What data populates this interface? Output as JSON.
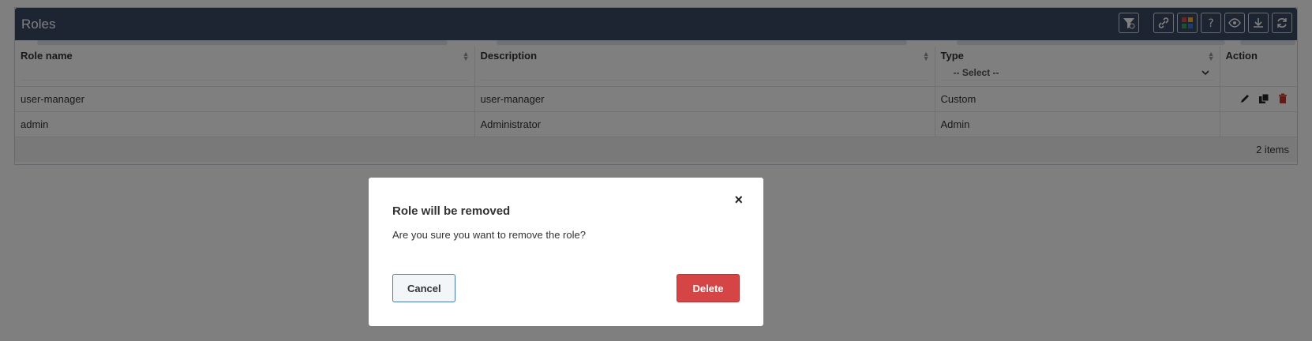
{
  "panel": {
    "title": "Roles"
  },
  "toolbar": {
    "icons": [
      "filter-settings-icon",
      "link-icon",
      "color-grid-icon",
      "help-icon",
      "eye-icon",
      "download-icon",
      "refresh-icon"
    ]
  },
  "table": {
    "columns": [
      {
        "label": "Role name",
        "filter": ""
      },
      {
        "label": "Description",
        "filter": ""
      },
      {
        "label": "Type",
        "filter": "-- Select --"
      },
      {
        "label": "Action"
      }
    ],
    "rows": [
      {
        "name": "user-manager",
        "description": "user-manager",
        "type": "Custom",
        "actions": [
          "edit-icon",
          "copy-icon",
          "delete-icon"
        ]
      },
      {
        "name": "admin",
        "description": "Administrator",
        "type": "Admin",
        "actions": []
      }
    ],
    "footer": "2 items"
  },
  "modal": {
    "close": "×",
    "title": "Role will be removed",
    "message": "Are you sure you want to remove the role?",
    "cancel_label": "Cancel",
    "delete_label": "Delete"
  },
  "colors": {
    "header": "#3a4a66",
    "danger": "#d64545",
    "accent": "#4a7ab5"
  }
}
